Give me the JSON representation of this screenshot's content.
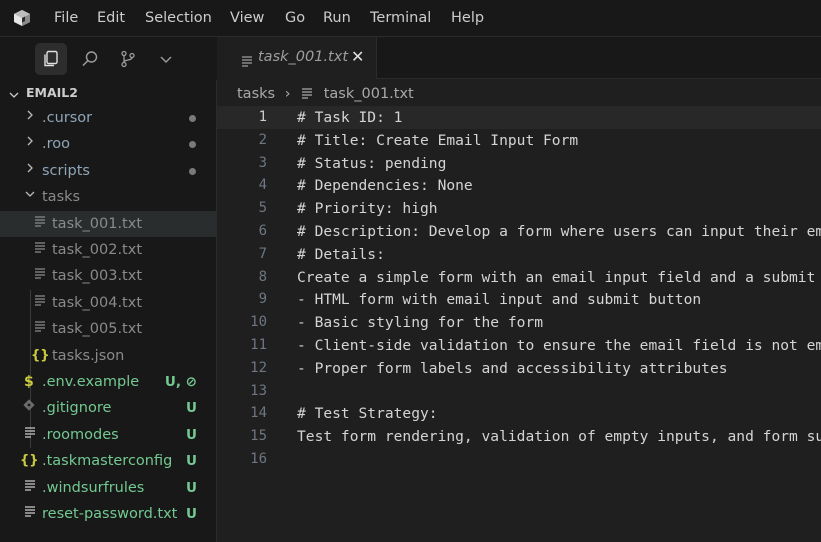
{
  "menu": [
    "File",
    "Edit",
    "Selection",
    "View",
    "Go",
    "Run",
    "Terminal",
    "Help"
  ],
  "explorer": {
    "root": "EMAIL2",
    "items": [
      {
        "label": ".cursor",
        "type": "folder",
        "status": "dot"
      },
      {
        "label": ".roo",
        "type": "folder",
        "status": "dot"
      },
      {
        "label": "scripts",
        "type": "folder",
        "status": "dot"
      },
      {
        "label": "tasks",
        "type": "folder-open",
        "status": ""
      },
      {
        "label": "task_001.txt",
        "type": "file",
        "status": "",
        "selected": true
      },
      {
        "label": "task_002.txt",
        "type": "file",
        "status": ""
      },
      {
        "label": "task_003.txt",
        "type": "file",
        "status": ""
      },
      {
        "label": "task_004.txt",
        "type": "file",
        "status": ""
      },
      {
        "label": "task_005.txt",
        "type": "file",
        "status": ""
      },
      {
        "label": "tasks.json",
        "type": "json",
        "status": ""
      },
      {
        "label": ".env.example",
        "type": "env",
        "status": "U, ⊘"
      },
      {
        "label": ".gitignore",
        "type": "git",
        "status": "U"
      },
      {
        "label": ".roomodes",
        "type": "file",
        "status": "U"
      },
      {
        "label": ".taskmasterconfig",
        "type": "json",
        "status": "U"
      },
      {
        "label": ".windsurfrules",
        "type": "file",
        "status": "U"
      },
      {
        "label": "reset-password.txt",
        "type": "file",
        "status": "U"
      }
    ]
  },
  "tab": {
    "label": "task_001.txt",
    "close": "✕"
  },
  "breadcrumb": {
    "folder": "tasks",
    "separator": "›",
    "file": "task_001.txt"
  },
  "editor": {
    "current_line": 1,
    "lines": [
      "# Task ID: 1",
      "# Title: Create Email Input Form",
      "# Status: pending",
      "# Dependencies: None",
      "# Priority: high",
      "# Description: Develop a form where users can input their emai",
      "# Details:",
      "Create a simple form with an email input field and a submit but",
      "- HTML form with email input and submit button",
      "- Basic styling for the form",
      "- Client-side validation to ensure the email field is not empty",
      "- Proper form labels and accessibility attributes",
      "",
      "# Test Strategy:",
      "Test form rendering, validation of empty inputs, and form subm",
      ""
    ]
  },
  "colors": {
    "accent_untracked": "#73c991",
    "json_icon": "#cbcb41",
    "env_icon": "#cbcb41"
  }
}
